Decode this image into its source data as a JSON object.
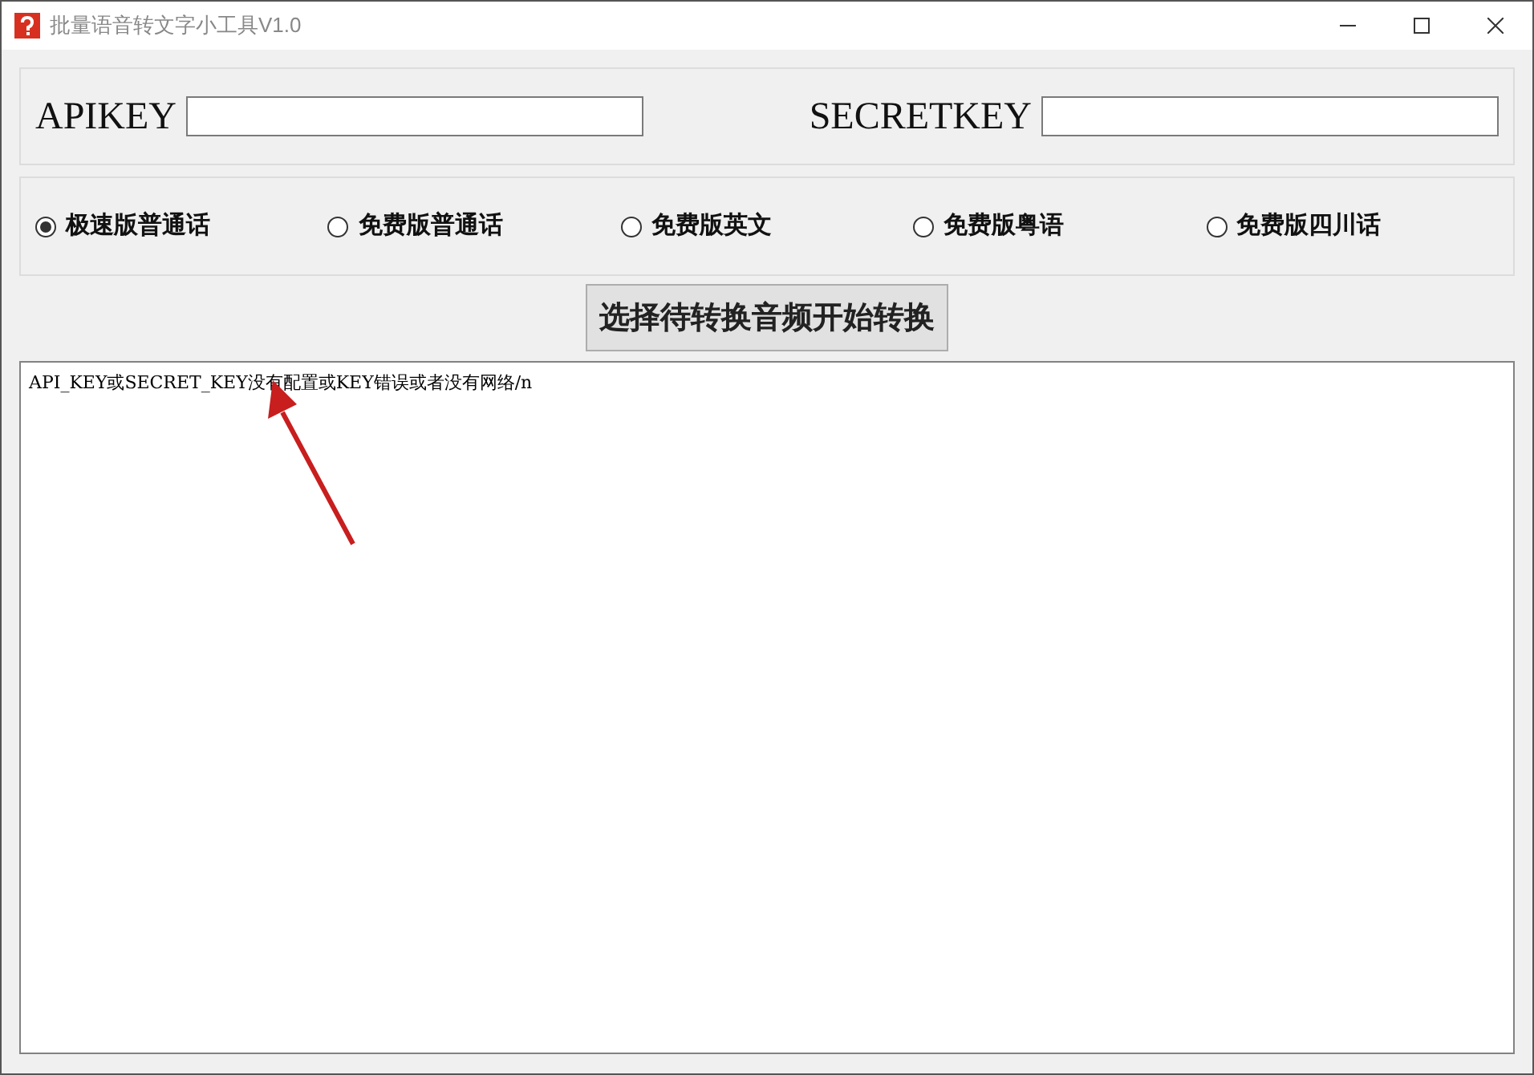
{
  "window": {
    "title": "批量语音转文字小工具V1.0"
  },
  "credentials": [
    {
      "label": "APIKEY"
    },
    {
      "label": "SECRETKEY"
    }
  ],
  "modes": [
    {
      "label": "极速版普通话",
      "selected": true
    },
    {
      "label": "免费版普通话",
      "selected": false
    },
    {
      "label": "免费版英文",
      "selected": false
    },
    {
      "label": "免费版粤语",
      "selected": false
    },
    {
      "label": "免费版四川话",
      "selected": false
    }
  ],
  "convert_button": "选择待转换音频开始转换",
  "output": {
    "text": "API_KEY或SECRET_KEY没有配置或KEY错误或者没有网络/n"
  }
}
